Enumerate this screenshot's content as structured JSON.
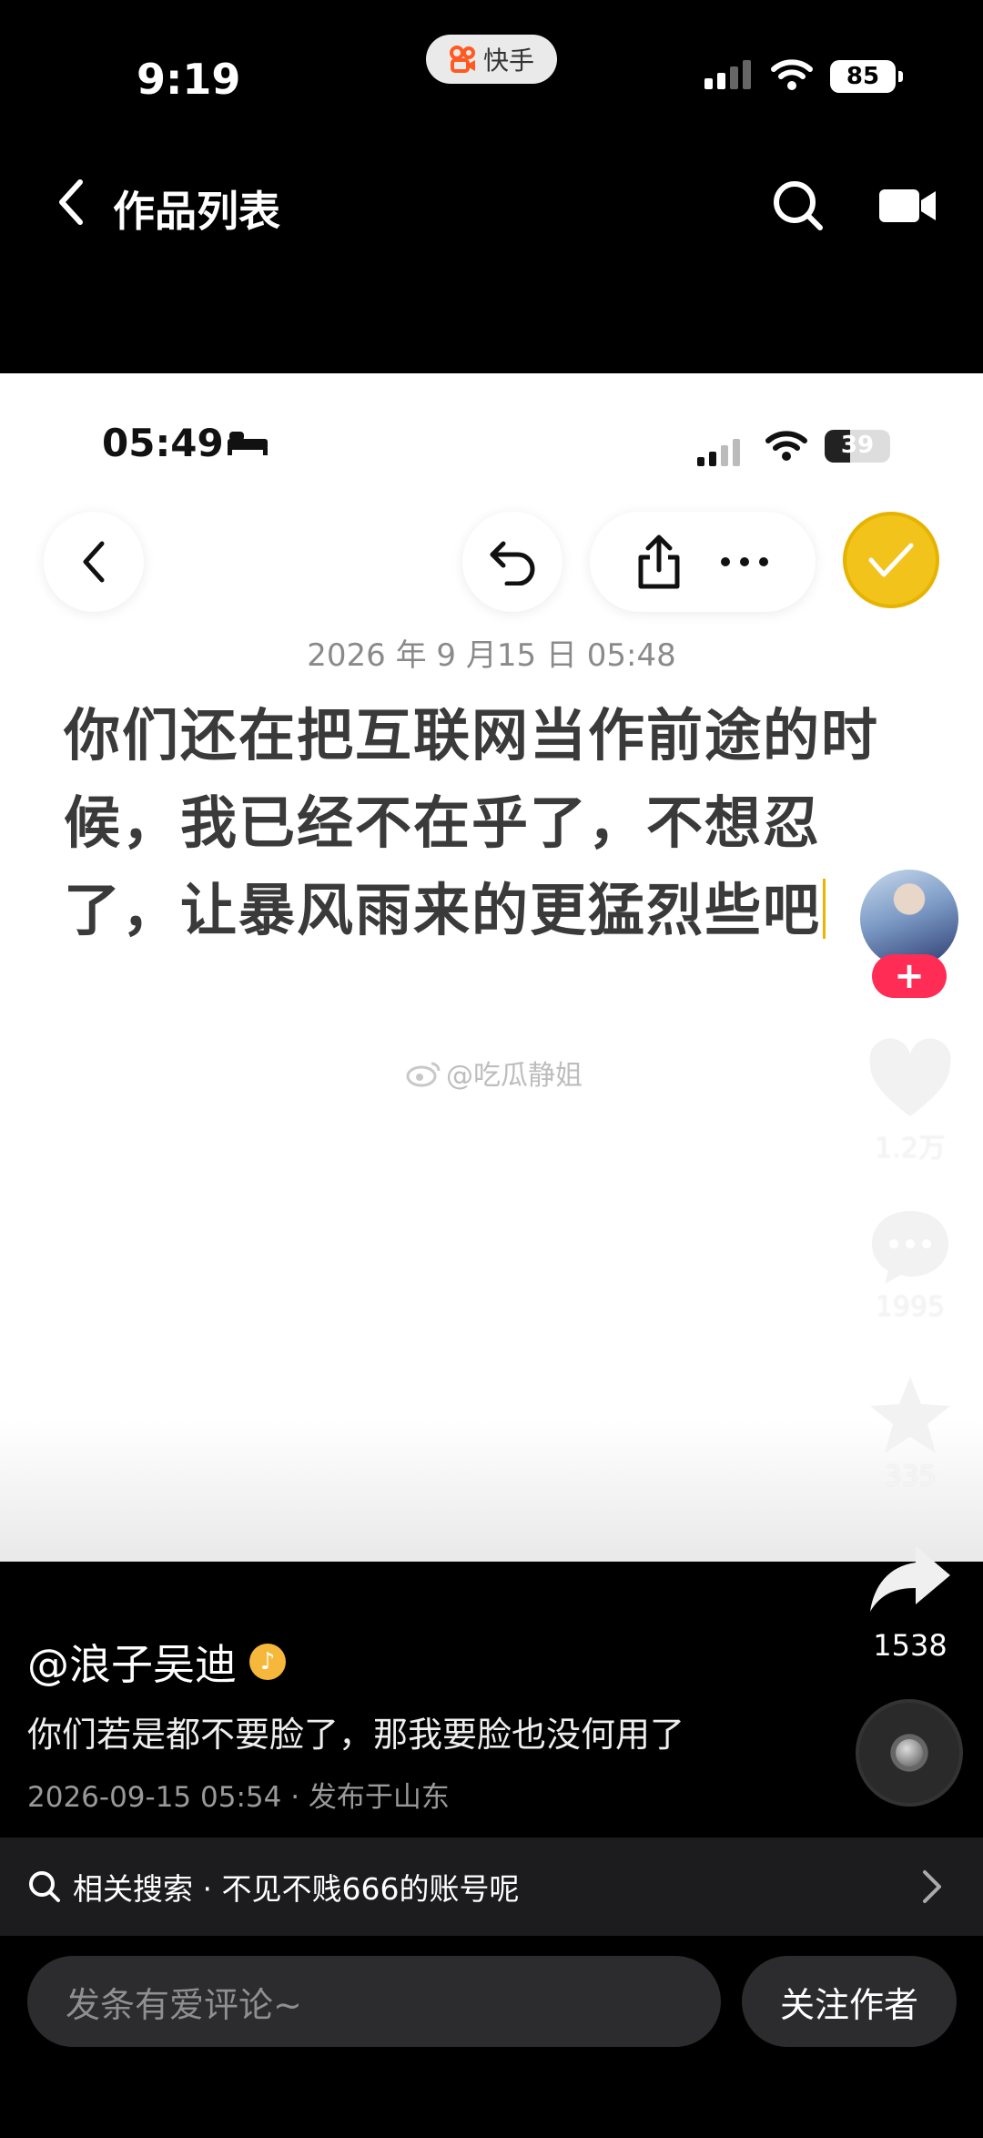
{
  "os_status": {
    "time": "9:19",
    "app_pill": "快手",
    "battery": "85"
  },
  "outer_nav": {
    "title": "作品列表"
  },
  "inner_status": {
    "time": "05:49",
    "battery": "39",
    "battery_level": 0.39
  },
  "note": {
    "date": "2026 年 9 月15 日 05:48",
    "lines": [
      "你们还在把互联网当作前途的时",
      "候，我已经不在乎了，不想忍",
      "了，让暴风雨来的更猛烈些吧"
    ]
  },
  "watermark": "@吃瓜静姐",
  "actions": {
    "follow_plus": "+",
    "likes": "1.2万",
    "comments": "1995",
    "favorites": "335",
    "shares": "1538"
  },
  "post": {
    "author": "@浪子吴迪",
    "caption": "你们若是都不要脸了，那我要脸也没何用了",
    "meta": "2026-09-15 05:54 · 发布于山东"
  },
  "related_search": {
    "label": "相关搜索 · 不见不贱666的账号呢"
  },
  "bottom": {
    "comment_placeholder": "发条有爱评论~",
    "follow_label": "关注作者"
  }
}
